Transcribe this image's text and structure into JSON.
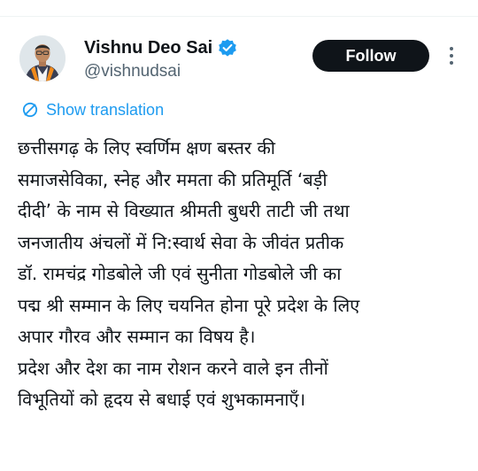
{
  "author": {
    "display_name": "Vishnu Deo Sai",
    "handle": "@vishnudsai",
    "verified": true,
    "avatar_icon": "profile-photo"
  },
  "actions": {
    "follow_label": "Follow",
    "more_icon": "more-vertical-icon"
  },
  "translation": {
    "label": "Show translation",
    "icon": "translate-icon"
  },
  "tweet": {
    "lines": [
      "छत्तीसगढ़ के लिए स्वर्णिम क्षण बस्तर की",
      "समाजसेविका, स्नेह और ममता की प्रतिमूर्ति ‘बड़ी",
      "दीदी’ के नाम से विख्यात श्रीमती बुधरी ताटी जी तथा",
      "जनजातीय अंचलों में नि:स्वार्थ सेवा के जीवंत प्रतीक",
      "डॉ. रामचंद्र गोडबोले जी एवं सुनीता गोडबोले जी का",
      "पद्म श्री सम्मान के लिए चयनित होना पूरे प्रदेश के लिए",
      "अपार गौरव और सम्मान का विषय है।",
      "प्रदेश और देश का नाम रोशन करने वाले इन तीनों",
      "विभूतियों को हृदय से बधाई एवं शुभकामनाएँ।"
    ]
  },
  "colors": {
    "accent": "#1d9bf0",
    "text_primary": "#0f1419",
    "text_secondary": "#536471",
    "button_bg": "#0f1419"
  }
}
